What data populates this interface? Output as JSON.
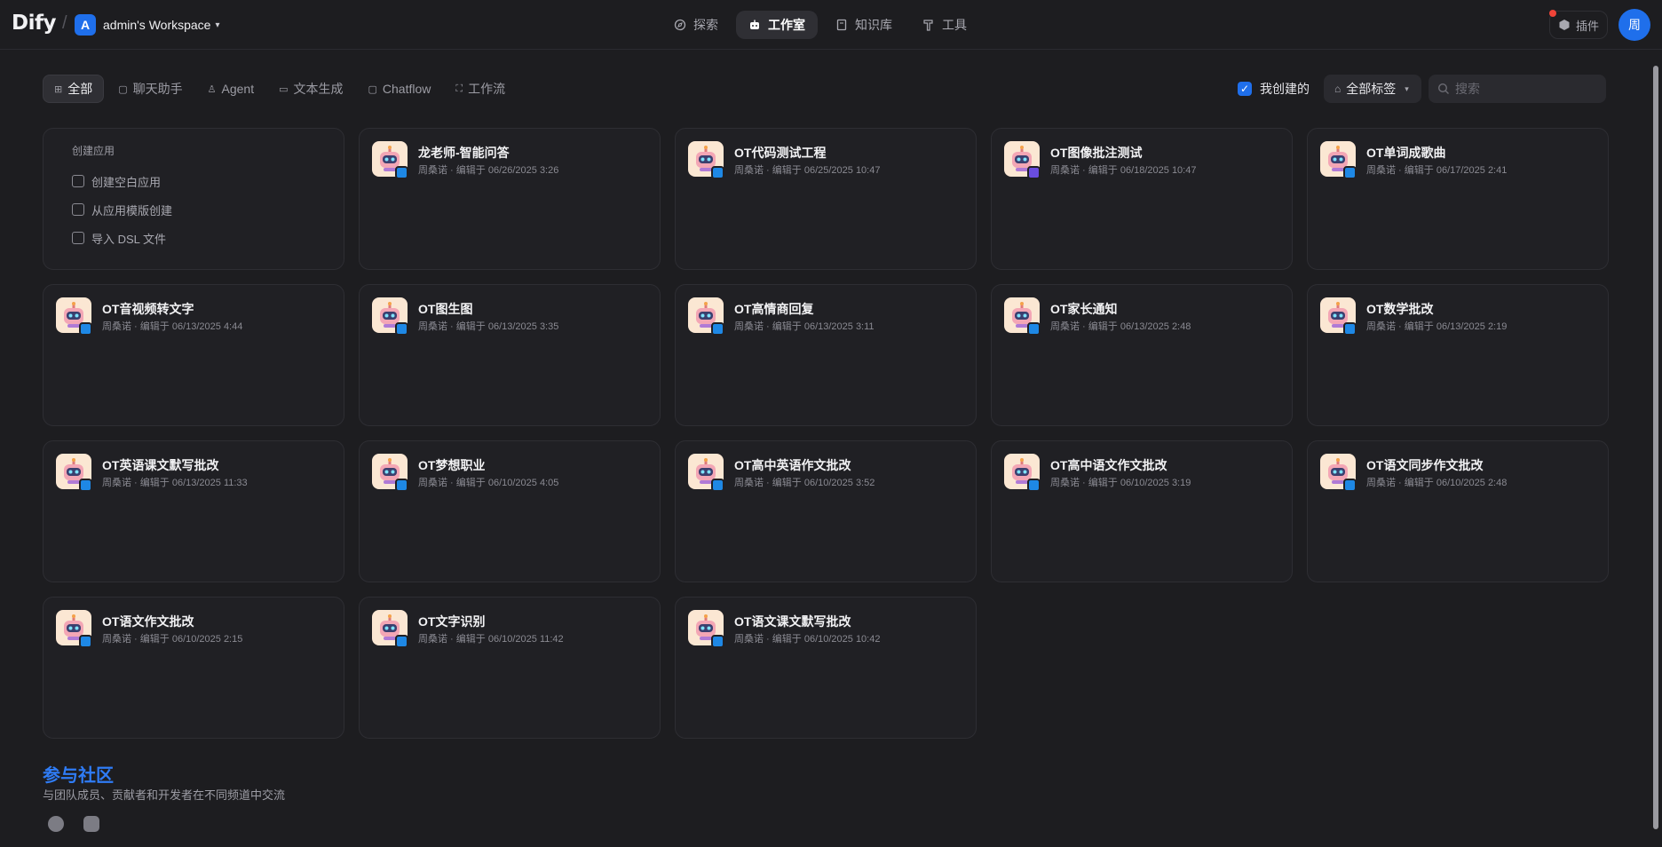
{
  "header": {
    "logo": "Dify",
    "workspace_initial": "A",
    "workspace_name": "admin's Workspace",
    "nav": [
      {
        "label": "探索",
        "icon": "compass-icon",
        "active": false
      },
      {
        "label": "工作室",
        "icon": "robot-icon",
        "active": true
      },
      {
        "label": "知识库",
        "icon": "book-icon",
        "active": false
      },
      {
        "label": "工具",
        "icon": "hammer-icon",
        "active": false
      }
    ],
    "plugins_label": "插件",
    "user_initial": "周"
  },
  "filters": {
    "tabs": [
      {
        "label": "全部",
        "active": true
      },
      {
        "label": "聊天助手",
        "active": false
      },
      {
        "label": "Agent",
        "active": false
      },
      {
        "label": "文本生成",
        "active": false
      },
      {
        "label": "Chatflow",
        "active": false
      },
      {
        "label": "工作流",
        "active": false
      }
    ],
    "mine_label": "我创建的",
    "tags_label": "全部标签",
    "search_placeholder": "搜索"
  },
  "create": {
    "title": "创建应用",
    "items": [
      "创建空白应用",
      "从应用模版创建",
      "导入 DSL 文件"
    ]
  },
  "apps": [
    {
      "name": "龙老师-智能问答",
      "meta": "周桑诺 · 编辑于 06/26/2025 3:26",
      "badge": "chat"
    },
    {
      "name": "OT代码测试工程",
      "meta": "周桑诺 · 编辑于 06/25/2025 10:47",
      "badge": "chat"
    },
    {
      "name": "OT图像批注测试",
      "meta": "周桑诺 · 编辑于 06/18/2025 10:47",
      "badge": "agent"
    },
    {
      "name": "OT单词成歌曲",
      "meta": "周桑诺 · 编辑于 06/17/2025 2:41",
      "badge": "chat"
    },
    {
      "name": "OT音视频转文字",
      "meta": "周桑诺 · 编辑于 06/13/2025 4:44",
      "badge": "chat"
    },
    {
      "name": "OT图生图",
      "meta": "周桑诺 · 编辑于 06/13/2025 3:35",
      "badge": "chat"
    },
    {
      "name": "OT高情商回复",
      "meta": "周桑诺 · 编辑于 06/13/2025 3:11",
      "badge": "chat"
    },
    {
      "name": "OT家长通知",
      "meta": "周桑诺 · 编辑于 06/13/2025 2:48",
      "badge": "chat"
    },
    {
      "name": "OT数学批改",
      "meta": "周桑诺 · 编辑于 06/13/2025 2:19",
      "badge": "chat"
    },
    {
      "name": "OT英语课文默写批改",
      "meta": "周桑诺 · 编辑于 06/13/2025 11:33",
      "badge": "chat"
    },
    {
      "name": "OT梦想职业",
      "meta": "周桑诺 · 编辑于 06/10/2025 4:05",
      "badge": "chat"
    },
    {
      "name": "OT高中英语作文批改",
      "meta": "周桑诺 · 编辑于 06/10/2025 3:52",
      "badge": "chat"
    },
    {
      "name": "OT高中语文作文批改",
      "meta": "周桑诺 · 编辑于 06/10/2025 3:19",
      "badge": "chat"
    },
    {
      "name": "OT语文同步作文批改",
      "meta": "周桑诺 · 编辑于 06/10/2025 2:48",
      "badge": "chat"
    },
    {
      "name": "OT语文作文批改",
      "meta": "周桑诺 · 编辑于 06/10/2025 2:15",
      "badge": "chat"
    },
    {
      "name": "OT文字识别",
      "meta": "周桑诺 · 编辑于 06/10/2025 11:42",
      "badge": "chat"
    },
    {
      "name": "OT语文课文默写批改",
      "meta": "周桑诺 · 编辑于 06/10/2025 10:42",
      "badge": "chat"
    }
  ],
  "community": {
    "title": "参与社区",
    "subtitle": "与团队成员、贡献者和开发者在不同频道中交流",
    "links": [
      "github-icon",
      "discord-icon"
    ]
  }
}
